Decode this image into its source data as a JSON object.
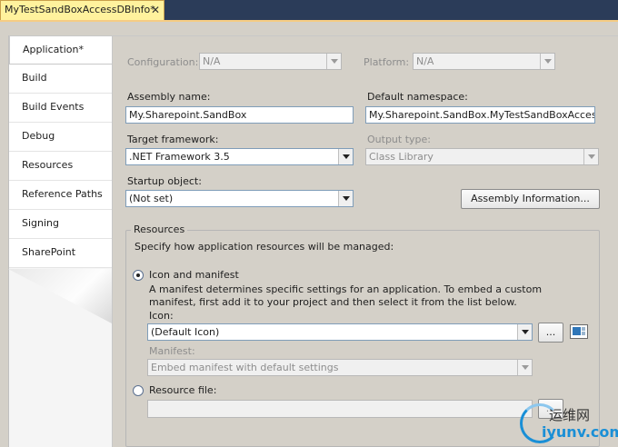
{
  "document_tab": {
    "title": "MyTestSandBoxAccessDBInfo*",
    "close_glyph": "✕"
  },
  "side_tabs": [
    {
      "label": "Application*",
      "active": true
    },
    {
      "label": "Build"
    },
    {
      "label": "Build Events"
    },
    {
      "label": "Debug"
    },
    {
      "label": "Resources"
    },
    {
      "label": "Reference Paths"
    },
    {
      "label": "Signing"
    },
    {
      "label": "SharePoint"
    }
  ],
  "configuration": {
    "label": "Configuration:",
    "value": "N/A"
  },
  "platform": {
    "label": "Platform:",
    "value": "N/A"
  },
  "assembly_name": {
    "label": "Assembly name:",
    "value": "My.Sharepoint.SandBox"
  },
  "default_namespace": {
    "label": "Default namespace:",
    "value": "My.Sharepoint.SandBox.MyTestSandBoxAccessDBI"
  },
  "target_framework": {
    "label": "Target framework:",
    "value": ".NET Framework 3.5"
  },
  "output_type": {
    "label": "Output type:",
    "value": "Class Library"
  },
  "startup_object": {
    "label": "Startup object:",
    "value": "(Not set)"
  },
  "assembly_info_button": "Assembly Information...",
  "resources": {
    "title": "Resources",
    "description": "Specify how application resources will be managed:",
    "icon_manifest_option": "Icon and manifest",
    "icon_manifest_desc": "A manifest determines specific settings for an application. To embed a custom manifest, first add it to your project and then select it from the list below.",
    "icon_label": "Icon:",
    "icon_value": "(Default Icon)",
    "browse_label": "...",
    "manifest_label": "Manifest:",
    "manifest_value": "Embed manifest with default settings",
    "resource_file_option": "Resource file:",
    "resource_file_value": ""
  },
  "watermark": {
    "cn": "运维网",
    "site": "iyunv.com"
  }
}
